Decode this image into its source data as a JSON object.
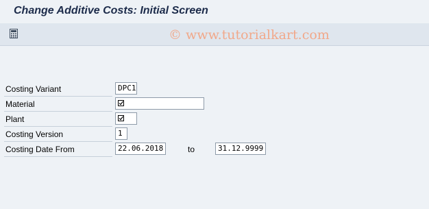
{
  "window": {
    "title": "Change Additive Costs: Initial Screen"
  },
  "toolbar": {
    "watermark": "© www.tutorialkart.com",
    "calculator_icon": "calculator-icon"
  },
  "form": {
    "costing_variant": {
      "label": "Costing Variant",
      "value": "DPC1"
    },
    "material": {
      "label": "Material",
      "value": "",
      "required": true
    },
    "plant": {
      "label": "Plant",
      "value": "",
      "required": true
    },
    "costing_version": {
      "label": "Costing Version",
      "value": "1"
    },
    "costing_date_from": {
      "label": "Costing Date From",
      "value": "22.06.2018",
      "to_label": "to",
      "to_value": "31.12.9999"
    }
  }
}
